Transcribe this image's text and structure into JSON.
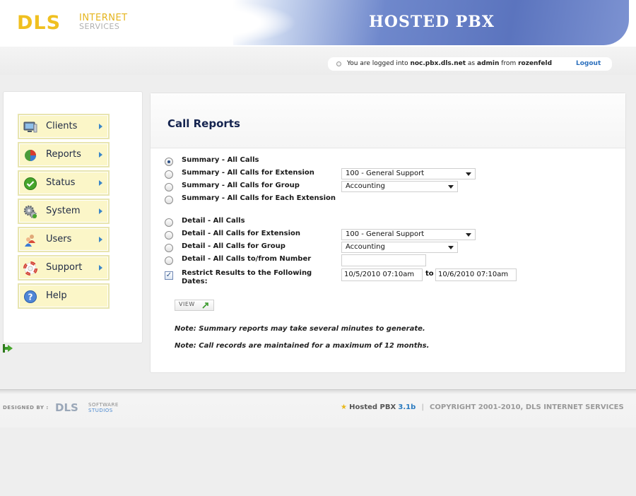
{
  "header": {
    "logo": {
      "main": "DLS",
      "line1": "INTERNET",
      "line2": "SERVICES"
    },
    "app_title": "HOSTED PBX"
  },
  "login": {
    "prefix": "You are logged into",
    "host": "noc.pbx.dls.net",
    "as_text": "as",
    "user": "admin",
    "from_text": "from",
    "location": "rozenfeld",
    "logout_label": "Logout"
  },
  "sidebar": {
    "items": [
      {
        "label": "Clients",
        "icon": "monitor-icon",
        "has_arrow": true
      },
      {
        "label": "Reports",
        "icon": "pie-chart-icon",
        "has_arrow": true
      },
      {
        "label": "Status",
        "icon": "checkmark-icon",
        "has_arrow": true
      },
      {
        "label": "System",
        "icon": "gears-icon",
        "has_arrow": true
      },
      {
        "label": "Users",
        "icon": "users-icon",
        "has_arrow": true
      },
      {
        "label": "Support",
        "icon": "lifebuoy-icon",
        "has_arrow": true
      },
      {
        "label": "Help",
        "icon": "help-icon",
        "has_arrow": false
      }
    ]
  },
  "main": {
    "title": "Call Reports",
    "options": [
      {
        "label": "Summary - All Calls",
        "selected": true
      },
      {
        "label": "Summary - All Calls for Extension",
        "selected": false,
        "select_value": "100 - General Support"
      },
      {
        "label": "Summary - All Calls for Group",
        "selected": false,
        "select_value": "Accounting"
      },
      {
        "label": "Summary - All Calls for Each Extension",
        "selected": false
      },
      {
        "label": "Detail - All Calls",
        "selected": false
      },
      {
        "label": "Detail - All Calls for Extension",
        "selected": false,
        "select_value": "100 - General Support"
      },
      {
        "label": "Detail - All Calls for Group",
        "selected": false,
        "select_value": "Accounting"
      },
      {
        "label": "Detail - All Calls to/from Number",
        "selected": false,
        "input_value": ""
      }
    ],
    "restrict": {
      "checked": true,
      "label_line1": "Restrict Results to the Following",
      "label_line2": "Dates:",
      "start": "10/5/2010 07:10am",
      "separator": "to",
      "end": "10/6/2010 07:10am"
    },
    "view_button": "VIEW",
    "notes": [
      "Note: Summary reports may take several minutes to generate.",
      "Note: Call records are maintained for a maximum of 12 months."
    ]
  },
  "footer": {
    "designed_by": "DESIGNED BY :",
    "studio_logo": {
      "main": "DLS",
      "line1": "SOFTWARE",
      "line2": "STUDIOS"
    },
    "product": "Hosted PBX",
    "version": "3.1b",
    "copyright": "COPYRIGHT 2001-2010, DLS INTERNET SERVICES"
  },
  "colors": {
    "header_blue": "#5b74be",
    "nav_bg": "#fbf6c8",
    "title_navy": "#15244f",
    "link_blue": "#2b6fbd",
    "logo_yellow": "#f0c020"
  }
}
